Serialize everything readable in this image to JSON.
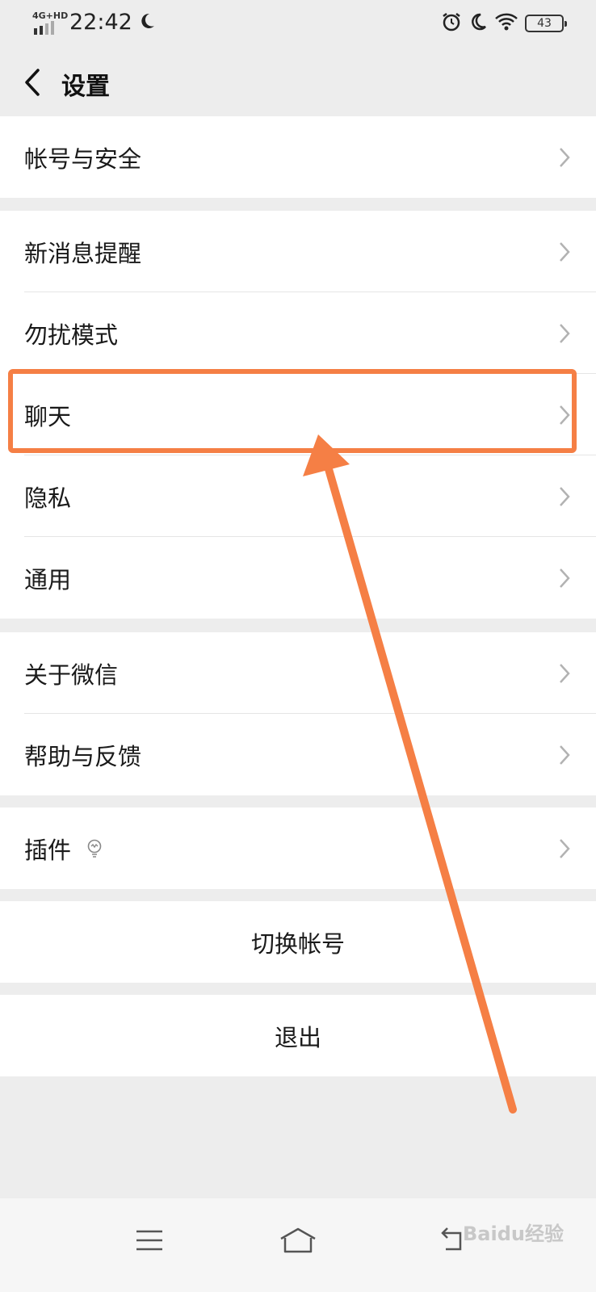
{
  "status_bar": {
    "network": "4G+HD",
    "time": "22:42",
    "battery": "43",
    "icons": [
      "signal-icon",
      "moon-icon",
      "alarm-icon",
      "wifi-icon",
      "battery-icon"
    ]
  },
  "nav": {
    "title": "设置",
    "back_icon": "chevron-left-icon"
  },
  "groups": [
    {
      "items": [
        "帐号与安全"
      ]
    },
    {
      "items": [
        "新消息提醒",
        "勿扰模式",
        "聊天",
        "隐私",
        "通用"
      ]
    },
    {
      "items": [
        "关于微信",
        "帮助与反馈"
      ]
    },
    {
      "items": [
        "插件"
      ]
    },
    {
      "items": [
        "切换帐号"
      ]
    },
    {
      "items": [
        "退出"
      ]
    }
  ],
  "highlighted_item": "聊天",
  "annotation": {
    "color": "#f57f45"
  },
  "system_nav": {
    "buttons": [
      "menu-icon",
      "home-icon",
      "back-icon"
    ]
  },
  "watermark": "Baidu经验",
  "colors": {
    "background": "#ededed",
    "card": "#ffffff",
    "accent": "#f57f45"
  }
}
